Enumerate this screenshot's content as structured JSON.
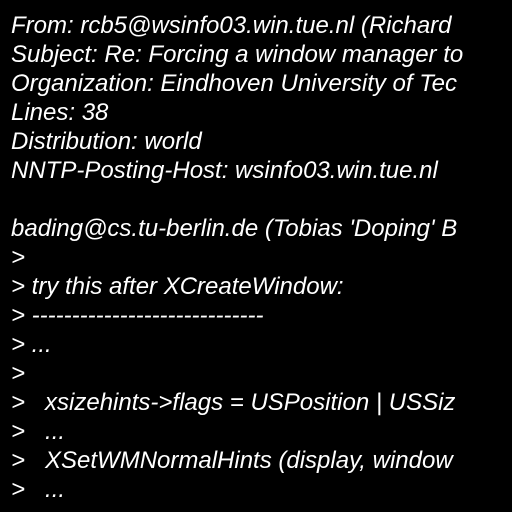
{
  "message": {
    "headers": {
      "from": "From: rcb5@wsinfo03.win.tue.nl (Richard",
      "subject": "Subject: Re: Forcing a window manager to",
      "organization": "Organization: Eindhoven University of Tec",
      "lines": "Lines: 38",
      "distribution": "Distribution: world",
      "nntp_posting_host": "NNTP-Posting-Host: wsinfo03.win.tue.nl"
    },
    "body": [
      "bading@cs.tu-berlin.de (Tobias 'Doping' B",
      ">",
      "> try this after XCreateWindow:",
      "> -----------------------------",
      "> ...",
      ">",
      ">   xsizehints->flags = USPosition | USSiz",
      ">   ...",
      ">   XSetWMNormalHints (display, window",
      ">   ..."
    ]
  },
  "colors": {
    "background": "#000000",
    "text": "#ffffff"
  }
}
